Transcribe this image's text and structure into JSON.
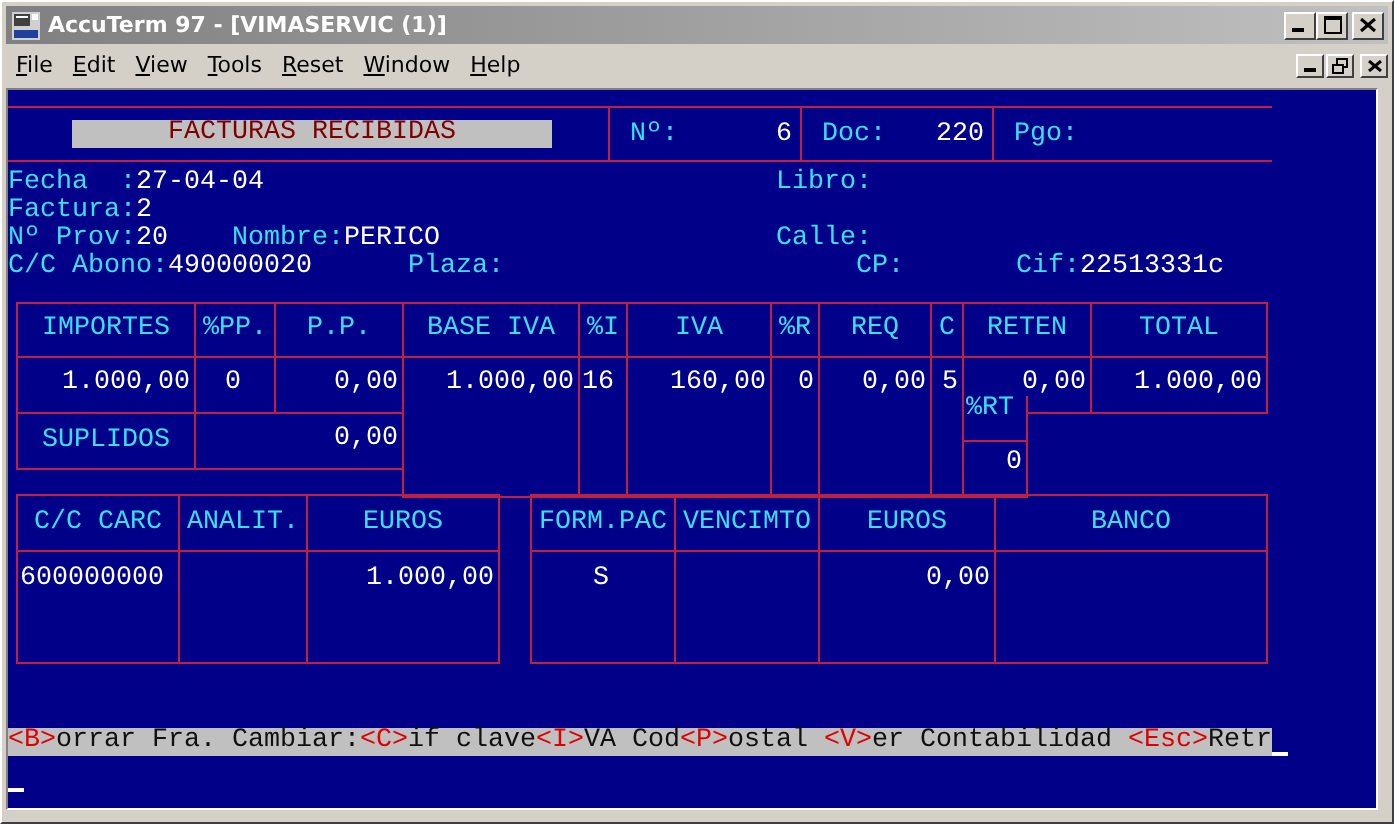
{
  "window": {
    "title": "AccuTerm 97 - [VIMASERVIC (1)]"
  },
  "menu": [
    "File",
    "Edit",
    "View",
    "Tools",
    "Reset",
    "Window",
    "Help"
  ],
  "header": {
    "title": "FACTURAS RECIBIDAS",
    "fields": [
      {
        "label": "Nº:",
        "value": "6"
      },
      {
        "label": "Doc:",
        "value": "220"
      },
      {
        "label": "Pgo:"
      }
    ]
  },
  "info_fields": [
    {
      "label": "Fecha  :",
      "value": "27-04-04"
    },
    {
      "label": "Libro:"
    },
    {
      "label": "Factura:",
      "value": "2"
    },
    {
      "label": "Nº Prov:",
      "value": "20"
    },
    {
      "label": "Nombre:",
      "value": "PERICO"
    },
    {
      "label": "Calle:"
    },
    {
      "label": "C/C Abono:",
      "value": "490000020"
    },
    {
      "label": "Plaza:"
    },
    {
      "label": "CP:"
    },
    {
      "label": "Cif:",
      "value": "22513331c"
    }
  ],
  "amounts_table": {
    "columns": [
      "IMPORTES",
      "%PP.",
      "P.P.",
      "BASE IVA",
      "%I",
      "IVA",
      "%R",
      "REQ",
      "C",
      "RETEN",
      "TOTAL"
    ],
    "values": [
      "1.000,00",
      "0",
      "0,00",
      "1.000,00",
      "16",
      "160,00",
      "0",
      "0,00",
      "5",
      "0,00",
      "1.000,00"
    ],
    "suplidos": {
      "label": "SUPLIDOS",
      "value": "0,00"
    },
    "retention_pct": {
      "label": "%RT",
      "value": "0"
    }
  },
  "charges_table": [
    {
      "label": "C/C CARC",
      "value": "600000000"
    },
    {
      "label": "ANALIT."
    },
    {
      "label": "EUROS",
      "value": "1.000,00"
    }
  ],
  "payments_table": [
    {
      "label": "FORM.PAC",
      "value": "S"
    },
    {
      "label": "VENCIMTO"
    },
    {
      "label": "EUROS",
      "value": "0,00"
    },
    {
      "label": "BANCO"
    }
  ],
  "command_bar": [
    {
      "kind": "key",
      "text": "<B>"
    },
    {
      "kind": "plain",
      "text": "orrar Fra. Cambiar:"
    },
    {
      "kind": "key",
      "text": "<C>"
    },
    {
      "kind": "plain",
      "text": "if clave"
    },
    {
      "kind": "key",
      "text": "<I>"
    },
    {
      "kind": "plain",
      "text": "VA Cod"
    },
    {
      "kind": "key",
      "text": "<P>"
    },
    {
      "kind": "plain",
      "text": "ostal "
    },
    {
      "kind": "key",
      "text": "<V>"
    },
    {
      "kind": "plain",
      "text": "er Contabilidad "
    },
    {
      "kind": "key",
      "text": "<Esc>"
    },
    {
      "kind": "plain",
      "text": "Retr"
    }
  ]
}
